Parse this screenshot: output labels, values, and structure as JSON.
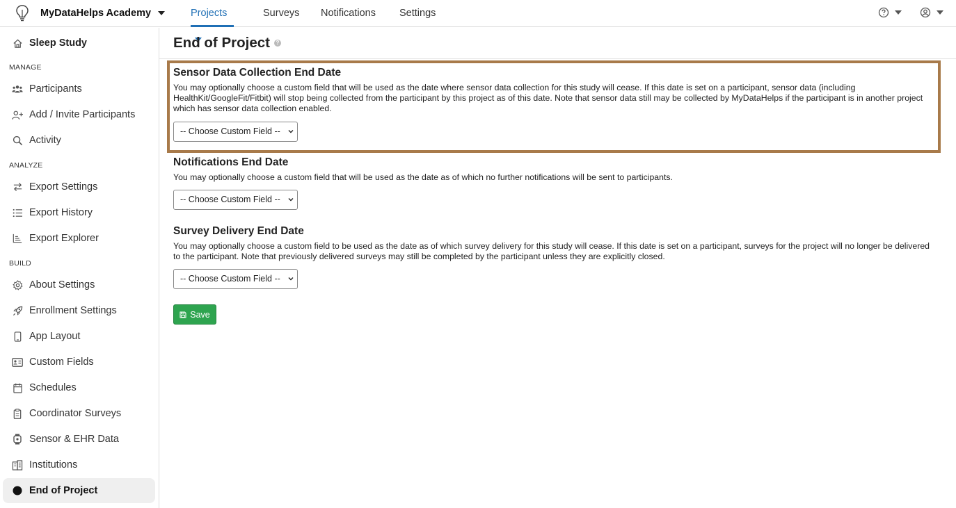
{
  "topbar": {
    "brand": "MyDataHelps Academy",
    "tabs": [
      {
        "label": "Projects"
      },
      {
        "label": "Surveys"
      },
      {
        "label": "Notifications"
      },
      {
        "label": "Settings"
      }
    ],
    "accent_color": "#1f6fb5"
  },
  "sidebar": {
    "project": "Sleep Study",
    "sections": {
      "manage": "MANAGE",
      "analyze": "ANALYZE",
      "build": "BUILD"
    },
    "items": [
      {
        "label": "Participants",
        "icon": "users-icon"
      },
      {
        "label": "Add / Invite Participants",
        "icon": "user-plus-icon"
      },
      {
        "label": "Activity",
        "icon": "search-icon"
      },
      {
        "label": "Export Settings",
        "icon": "arrows-exchange-icon"
      },
      {
        "label": "Export History",
        "icon": "list-icon"
      },
      {
        "label": "Export Explorer",
        "icon": "chart-line-icon"
      },
      {
        "label": "About Settings",
        "icon": "gear-icon"
      },
      {
        "label": "Enrollment Settings",
        "icon": "rocket-icon"
      },
      {
        "label": "App Layout",
        "icon": "mobile-icon"
      },
      {
        "label": "Custom Fields",
        "icon": "id-card-icon"
      },
      {
        "label": "Schedules",
        "icon": "calendar-icon"
      },
      {
        "label": "Coordinator Surveys",
        "icon": "clipboard-icon"
      },
      {
        "label": "Sensor & EHR Data",
        "icon": "watch-icon"
      },
      {
        "label": "Institutions",
        "icon": "building-icon"
      },
      {
        "label": "End of Project",
        "icon": "circle-icon"
      }
    ]
  },
  "main": {
    "title": "End of Project",
    "sensor": {
      "heading": "Sensor Data Collection End Date",
      "description": "You may optionally choose a custom field that will be used as the date where sensor data collection for this study will cease. If this date is set on a participant, sensor data (including HealthKit/GoogleFit/Fitbit) will stop being collected from the participant by this project as of this date. Note that sensor data still may be collected by MyDataHelps if the participant is in another project which has sensor data collection enabled.",
      "select_value": "-- Choose Custom Field --"
    },
    "notifications": {
      "heading": "Notifications End Date",
      "description": "You may optionally choose a custom field that will be used as the date as of which no further notifications will be sent to participants.",
      "select_value": "-- Choose Custom Field --"
    },
    "survey": {
      "heading": "Survey Delivery End Date",
      "description": "You may optionally choose a custom field to be used as the date as of which survey delivery for this study will cease. If this date is set on a participant, surveys for the project will no longer be delivered to the participant. Note that previously delivered surveys may still be completed by the participant unless they are explicitly closed.",
      "select_value": "-- Choose Custom Field --"
    },
    "save_label": "Save",
    "save_color": "#2ea44f",
    "highlight_color": "#a87a4a"
  }
}
